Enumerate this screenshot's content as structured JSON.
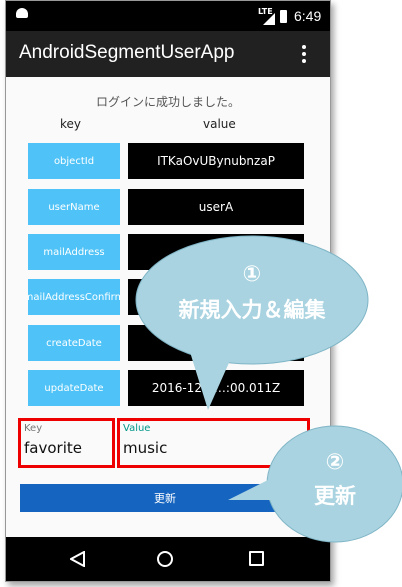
{
  "status": {
    "network": "LTE",
    "time": "6:49"
  },
  "app": {
    "title": "AndroidSegmentUserApp"
  },
  "message": "ログインに成功しました。",
  "table": {
    "key_header": "key",
    "value_header": "value",
    "rows": [
      {
        "key": "objectId",
        "value": "ITKaOvUBynubnzaP"
      },
      {
        "key": "userName",
        "value": "userA"
      },
      {
        "key": "mailAddress",
        "value": ""
      },
      {
        "key": "mailAddressConfirm",
        "value": ""
      },
      {
        "key": "createDate",
        "value": ""
      },
      {
        "key": "updateDate",
        "value": "2016-12-0…:00.011Z"
      }
    ]
  },
  "form": {
    "key_label": "Key",
    "key_value": "favorite",
    "value_label": "Value",
    "value_value": "music",
    "update_label": "更新"
  },
  "callouts": {
    "c1_number": "①",
    "c1_text": "新規入力＆編集",
    "c2_number": "②",
    "c2_text": "更新"
  },
  "colors": {
    "key_cell": "#4fc3f7",
    "value_cell": "#000000",
    "button": "#1565c0",
    "highlight": "#ee0000",
    "callout": "#a9d3e0",
    "value_label": "#009688"
  },
  "icons": {
    "back": "triangle-back-icon",
    "home": "circle-home-icon",
    "recent": "square-recent-icon",
    "menu": "more-vert-icon"
  }
}
